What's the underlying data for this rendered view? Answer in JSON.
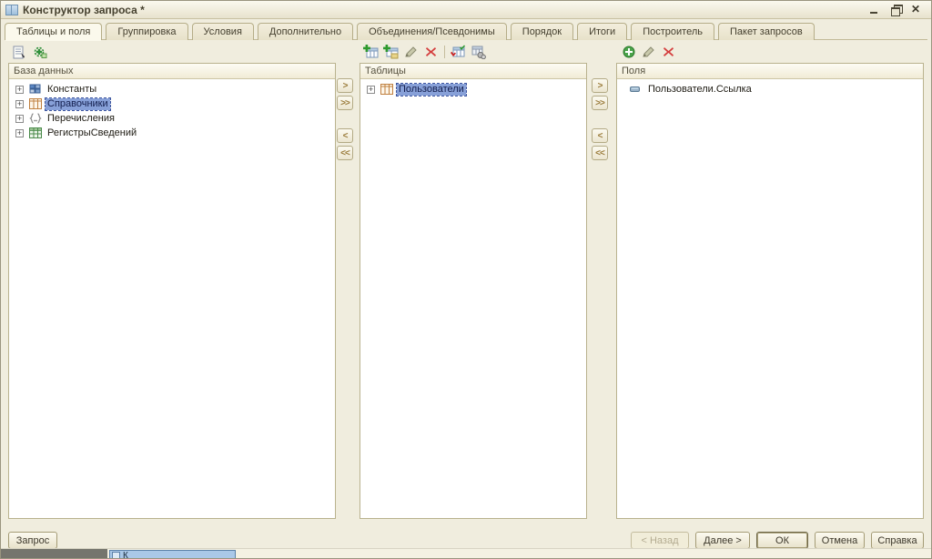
{
  "window": {
    "title": "Конструктор запроса *"
  },
  "tabs": [
    {
      "label": "Таблицы и поля",
      "active": true
    },
    {
      "label": "Группировка"
    },
    {
      "label": "Условия"
    },
    {
      "label": "Дополнительно"
    },
    {
      "label": "Объединения/Псевдонимы"
    },
    {
      "label": "Порядок"
    },
    {
      "label": "Итоги"
    },
    {
      "label": "Построитель"
    },
    {
      "label": "Пакет запросов"
    }
  ],
  "database_panel": {
    "header": "База данных",
    "expand_glyph": "+",
    "items": [
      {
        "label": "Константы",
        "icon": "constants-icon"
      },
      {
        "label": "Справочники",
        "icon": "catalog-table-icon",
        "selected": true
      },
      {
        "label": "Перечисления",
        "icon": "enum-braces-icon"
      },
      {
        "label": "РегистрыСведений",
        "icon": "inforegister-table-icon"
      }
    ]
  },
  "tables_panel": {
    "header": "Таблицы",
    "items": [
      {
        "label": "Пользователи",
        "icon": "catalog-table-icon",
        "selected": true
      }
    ]
  },
  "fields_panel": {
    "header": "Поля",
    "items": [
      {
        "label": "Пользователи.Ссылка",
        "icon": "field-icon"
      }
    ]
  },
  "transfer": {
    "right": ">",
    "right_all": ">>",
    "left": "<",
    "left_all": "<<"
  },
  "footer": {
    "query": "Запрос",
    "back": "< Назад",
    "next": "Далее >",
    "ok": "ОК",
    "cancel": "Отмена",
    "help": "Справка"
  },
  "taskbar": {
    "item_label": "К"
  },
  "colors": {
    "selection_blue": "#87a0d8",
    "delete_red": "#d43c3c",
    "add_green": "#3a9a3a",
    "panel_border_tan": "#b9b28e"
  }
}
